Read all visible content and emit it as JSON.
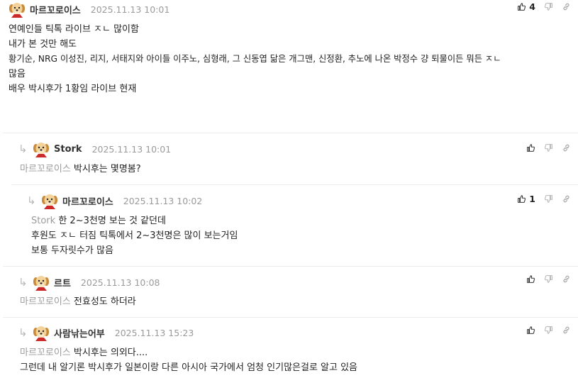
{
  "comments": [
    {
      "nick": "마르꼬로이스",
      "date": "2025.11.13 10:01",
      "like_count": "4",
      "lines": [
        "연예인들 틱톡 라이브 ㅈㄴ 많이함",
        "",
        "내가 본 것만 해도",
        "황기순, NRG 이성진, 리지, 서태지와 아이들 이주노, 심형래, 그 신동엽 닮은 개그맨, 신정환, 추노에 나온 박정수 걍 퇴물이든 뭐든 ㅈㄴ",
        "많음",
        "",
        "배우 박시후가 1황임 라이브 현재"
      ]
    },
    {
      "nick": "Stork",
      "date": "2025.11.13 10:01",
      "mention": "마르꼬로이스",
      "lines": [
        "박시후는 몇명봄?"
      ]
    },
    {
      "nick": "마르꼬로이스",
      "date": "2025.11.13 10:02",
      "like_count": "1",
      "mention": "Stork",
      "lines": [
        "한 2~3천명 보는 것 같던데",
        "후원도 ㅈㄴ 터짐 틱톡에서 2~3천명은 많이 보는거임",
        "보통 두자릿수가 많음"
      ]
    },
    {
      "nick": "르트",
      "date": "2025.11.13 10:08",
      "mention": "마르꼬로이스",
      "lines": [
        "전효성도 하더라"
      ]
    },
    {
      "nick": "사람낚는어부",
      "date": "2025.11.13 15:23",
      "mention": "마르꼬로이스",
      "lines": [
        "박시후는 의외다....",
        "그런데 내 알기론 박시후가 일본이랑 다른 아시아 국가에서 엄청 인기많은걸로 알고 있음"
      ]
    }
  ],
  "icons": {
    "reply": "reply-arrow-icon",
    "like": "thumbs-up-icon",
    "dislike": "thumbs-down-icon",
    "link": "link-icon",
    "avatar": "dog-avatar-icon"
  },
  "colors": {
    "mention": "#9b9b9b",
    "date": "#9a9a9a",
    "divider": "#ececec"
  }
}
